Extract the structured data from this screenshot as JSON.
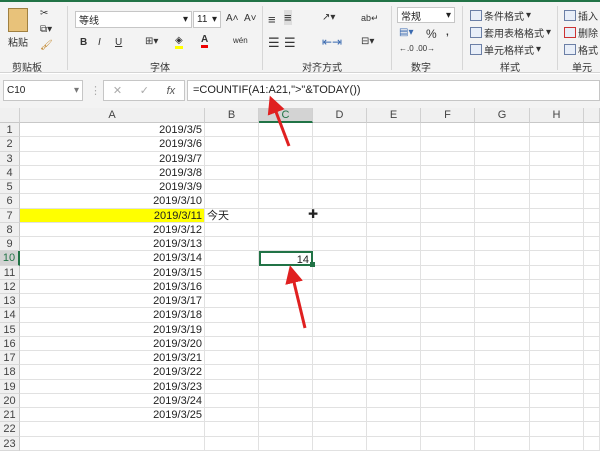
{
  "ribbon": {
    "clipboard": {
      "paste": "粘贴",
      "label": "剪贴板"
    },
    "font": {
      "name": "等线",
      "size": "11",
      "bold": "B",
      "italic": "I",
      "underline": "U",
      "label": "字体"
    },
    "alignment": {
      "label": "对齐方式"
    },
    "number": {
      "format": "常规",
      "percent": "%",
      "comma": ",",
      "label": "数字"
    },
    "styles": {
      "conditional": "条件格式",
      "table": "套用表格格式",
      "cell": "单元格样式",
      "label": "样式"
    },
    "cells": {
      "insert": "插入",
      "delete": "删除",
      "format": "格式",
      "label": "单元格"
    }
  },
  "formula_bar": {
    "name_box": "C10",
    "fx": "fx",
    "formula": "=COUNTIF(A1:A21,\">\"&TODAY())"
  },
  "columns": [
    "A",
    "B",
    "C",
    "D",
    "E",
    "F",
    "G",
    "H"
  ],
  "rows": [
    "1",
    "2",
    "3",
    "4",
    "5",
    "6",
    "7",
    "8",
    "9",
    "10",
    "11",
    "12",
    "13",
    "14",
    "15",
    "16",
    "17",
    "18",
    "19",
    "20",
    "21",
    "22",
    "23"
  ],
  "col_a": [
    "2019/3/5",
    "2019/3/6",
    "2019/3/7",
    "2019/3/8",
    "2019/3/9",
    "2019/3/10",
    "2019/3/11",
    "2019/3/12",
    "2019/3/13",
    "2019/3/14",
    "2019/3/15",
    "2019/3/16",
    "2019/3/17",
    "2019/3/18",
    "2019/3/19",
    "2019/3/20",
    "2019/3/21",
    "2019/3/22",
    "2019/3/23",
    "2019/3/24",
    "2019/3/25"
  ],
  "b7": "今天",
  "c10": "14",
  "colors": {
    "highlight": "#ffff00",
    "accent": "#217346",
    "arrow": "#e02020"
  }
}
